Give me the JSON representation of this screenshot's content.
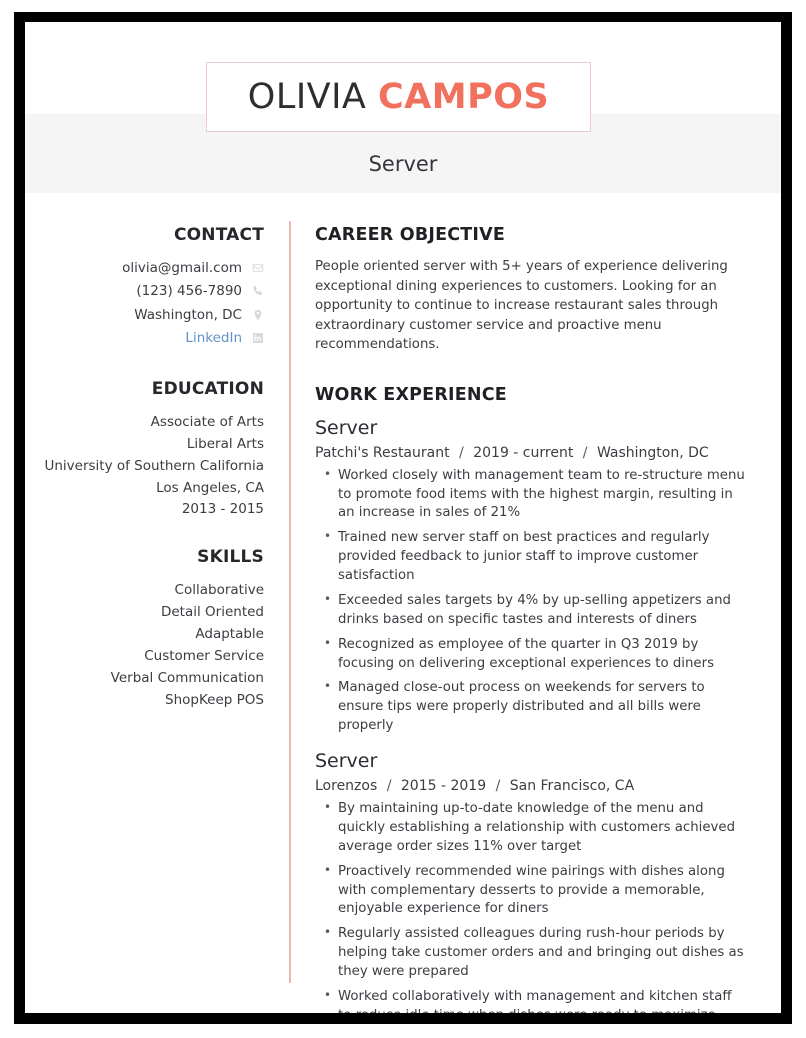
{
  "header": {
    "name_first": "OLIVIA",
    "name_last": "CAMPOS",
    "job_title": "Server",
    "accent_color": "#f1705e",
    "band_color": "#f5f5f6",
    "box_border_color": "#eccccb"
  },
  "sidebar": {
    "contact": {
      "heading": "CONTACT",
      "items": [
        {
          "text": "olivia@gmail.com",
          "icon": "envelope-icon",
          "is_link": false
        },
        {
          "text": "(123) 456-7890",
          "icon": "phone-icon",
          "is_link": false
        },
        {
          "text": "Washington, DC",
          "icon": "location-pin-icon",
          "is_link": false
        },
        {
          "text": "LinkedIn",
          "icon": "linkedin-icon",
          "is_link": true
        }
      ],
      "link_color": "#6092c6"
    },
    "education": {
      "heading": "EDUCATION",
      "items": [
        "Associate of Arts",
        "Liberal Arts",
        "University of Southern California",
        "Los Angeles, CA",
        "2013 - 2015"
      ]
    },
    "skills": {
      "heading": "SKILLS",
      "items": [
        "Collaborative",
        "Detail Oriented",
        "Adaptable",
        "Customer Service",
        "Verbal Communication",
        "ShopKeep POS"
      ]
    }
  },
  "main": {
    "objective": {
      "heading": "CAREER OBJECTIVE",
      "text": "People oriented server with 5+ years of experience delivering exceptional dining experiences to customers. Looking for an opportunity to continue to increase restaurant sales through extraordinary customer service and proactive menu recommendations."
    },
    "work": {
      "heading": "WORK EXPERIENCE",
      "jobs": [
        {
          "role": "Server",
          "company": "Patchi's Restaurant",
          "dates": "2019 - current",
          "location": "Washington, DC",
          "separator": "/",
          "bullets": [
            "Worked closely with management team to re-structure menu to promote food items with the highest margin, resulting in an increase in sales of 21%",
            "Trained new server staff on best practices and regularly provided feedback to junior staff to improve customer satisfaction",
            "Exceeded sales targets by 4% by up-selling appetizers and drinks based on specific tastes and interests of diners",
            "Recognized as employee of the quarter in Q3 2019 by focusing on delivering exceptional experiences to diners",
            "Managed close-out process on weekends for servers to ensure tips were properly distributed and all bills were properly"
          ]
        },
        {
          "role": "Server",
          "company": "Lorenzos",
          "dates": "2015 - 2019",
          "location": "San Francisco, CA",
          "separator": "/",
          "bullets": [
            "By maintaining up-to-date knowledge of the menu and quickly establishing a relationship with customers achieved average order sizes 11% over target",
            "Proactively recommended wine pairings with dishes along with complementary desserts to provide a memorable, enjoyable experience for diners",
            "Regularly assisted colleagues during rush-hour periods by helping take customer orders and and bringing out dishes as they were prepared",
            "Worked collaboratively with management and kitchen staff to reduce idle time when dishes were ready to maximize customer satisfaction"
          ]
        }
      ]
    }
  }
}
